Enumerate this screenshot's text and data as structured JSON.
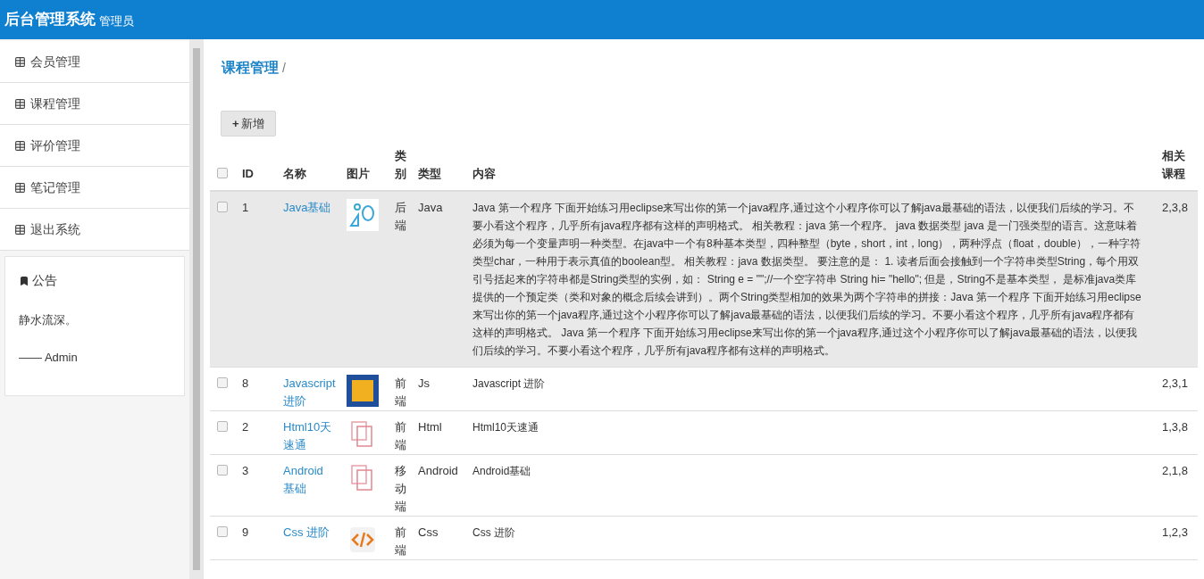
{
  "header": {
    "title": "后台管理系统",
    "role": "管理员"
  },
  "sidebar": {
    "items": [
      {
        "label": "会员管理"
      },
      {
        "label": "课程管理"
      },
      {
        "label": "评价管理"
      },
      {
        "label": "笔记管理"
      },
      {
        "label": "退出系统"
      }
    ],
    "notice": {
      "title": "公告",
      "text": "静水流深。",
      "signature": "—— Admin"
    }
  },
  "breadcrumb": {
    "current": "课程管理",
    "separator": "/"
  },
  "add_button": {
    "icon": "+",
    "label": "新增"
  },
  "table": {
    "columns": [
      "ID",
      "名称",
      "图片",
      "类别",
      "类型",
      "内容",
      "相关课程"
    ],
    "header_checkbox": {
      "checked": false
    },
    "rows": [
      {
        "checked": false,
        "highlighted": true,
        "id": "1",
        "name": "Java基础",
        "kind": "shapes",
        "category": "后端",
        "type": "Java",
        "content": "Java 第一个程序 下面开始练习用eclipse来写出你的第一个java程序,通过这个小程序你可以了解java最基础的语法，以便我们后续的学习。不要小看这个程序，几乎所有java程序都有这样的声明格式。 相关教程：java 第一个程序。 java 数据类型 java 是一门强类型的语言。这意味着必须为每一个变量声明一种类型。在java中一个有8种基本类型，四种整型（byte，short，int，long），两种浮点（float，double），一种字符类型char，一种用于表示真值的boolean型。 相关教程：java 数据类型。 要注意的是： 1. 读者后面会接触到一个字符串类型String，每个用双引号括起来的字符串都是String类型的实例，如： String e = \"\";//一个空字符串 String hi= \"hello\"; 但是，String不是基本类型， 是标准java类库提供的一个预定类（类和对象的概念后续会讲到）。两个String类型相加的效果为两个字符串的拼接：Java 第一个程序 下面开始练习用eclipse来写出你的第一个java程序,通过这个小程序你可以了解java最基础的语法，以便我们后续的学习。不要小看这个程序，几乎所有java程序都有这样的声明格式。 Java 第一个程序 下面开始练习用eclipse来写出你的第一个java程序,通过这个小程序你可以了解java最基础的语法，以便我们后续的学习。不要小看这个程序，几乎所有java程序都有这样的声明格式。",
        "related": "2,3,8"
      },
      {
        "checked": false,
        "highlighted": false,
        "id": "8",
        "name": "Javascript 进阶",
        "kind": "photo",
        "category": "前端",
        "type": "Js",
        "content": "Javascript 进阶",
        "related": "2,3,1"
      },
      {
        "checked": false,
        "highlighted": false,
        "id": "2",
        "name": "Html10天速通",
        "kind": "pages",
        "category": "前端",
        "type": "Html",
        "content": "Html10天速通",
        "related": "1,3,8"
      },
      {
        "checked": false,
        "highlighted": false,
        "id": "3",
        "name": "Android 基础",
        "kind": "pages",
        "category": "移动端",
        "type": "Android",
        "content": "Android基础",
        "related": "2,1,8"
      },
      {
        "checked": false,
        "highlighted": false,
        "id": "9",
        "name": "Css 进阶",
        "kind": "code",
        "category": "前端",
        "type": "Css",
        "content": "Css 进阶",
        "related": "1,2,3"
      }
    ]
  }
}
